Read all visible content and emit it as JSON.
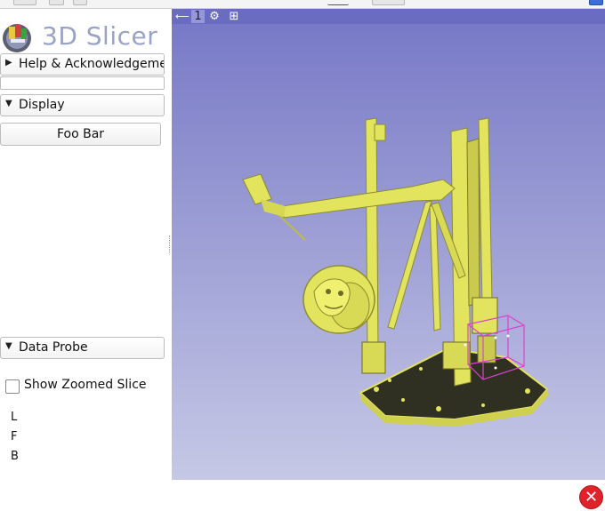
{
  "app": {
    "title": "3D Slicer"
  },
  "sections": {
    "help": {
      "label": "Help & Acknowledgeme"
    },
    "display": {
      "label": "Display",
      "button_label": "Foo Bar"
    },
    "data_probe": {
      "label": "Data Probe",
      "checkbox_label": "Show Zoomed Slice",
      "checkbox_checked": false,
      "coords": [
        "L",
        "F",
        "B"
      ]
    }
  },
  "view": {
    "view_number": "1",
    "icons": [
      "pin-icon",
      "center-view-icon",
      "layout-icon"
    ]
  },
  "colors": {
    "model": "#e3e45e",
    "roi_box": "#e040d0",
    "close": "#e0232a"
  }
}
